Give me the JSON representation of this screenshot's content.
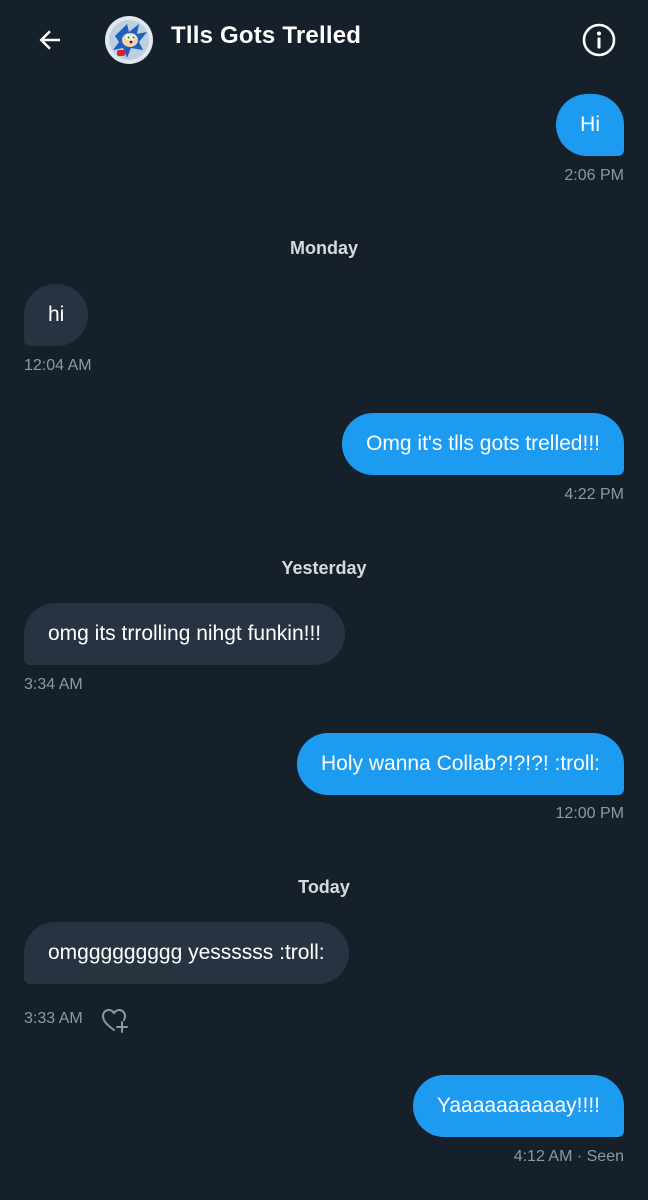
{
  "header": {
    "title": "Tlls Gots Trelled",
    "back_icon": "arrow-left-icon",
    "info_icon": "info-circle-icon",
    "avatar": "sonic-avatar"
  },
  "messages": [
    {
      "direction": "out",
      "text": "Hi",
      "time": "2:06 PM"
    },
    {
      "day_divider": "Monday"
    },
    {
      "direction": "in",
      "text": "hi",
      "time": "12:04 AM"
    },
    {
      "direction": "out",
      "text": "Omg it's tlls gots trelled!!!",
      "time": "4:22 PM"
    },
    {
      "day_divider": "Yesterday"
    },
    {
      "direction": "in",
      "text": "omg its trrolling nihgt funkin!!!",
      "time": "3:34 AM"
    },
    {
      "direction": "out",
      "text": "Holy wanna Collab?!?!?! :troll:",
      "time": "12:00 PM"
    },
    {
      "day_divider": "Today"
    },
    {
      "direction": "in",
      "text": "omggggggggg yessssss :troll:",
      "time": "3:33 AM",
      "reaction_icon": "heart-plus-icon"
    },
    {
      "direction": "out",
      "text": "Yaaaaaaaaaay!!!!",
      "time": "4:12 AM · Seen"
    }
  ],
  "colors": {
    "background": "#15202b",
    "outgoing_bubble": "#1d9bf0",
    "incoming_bubble": "#273340",
    "timestamp": "#8b98a5"
  }
}
